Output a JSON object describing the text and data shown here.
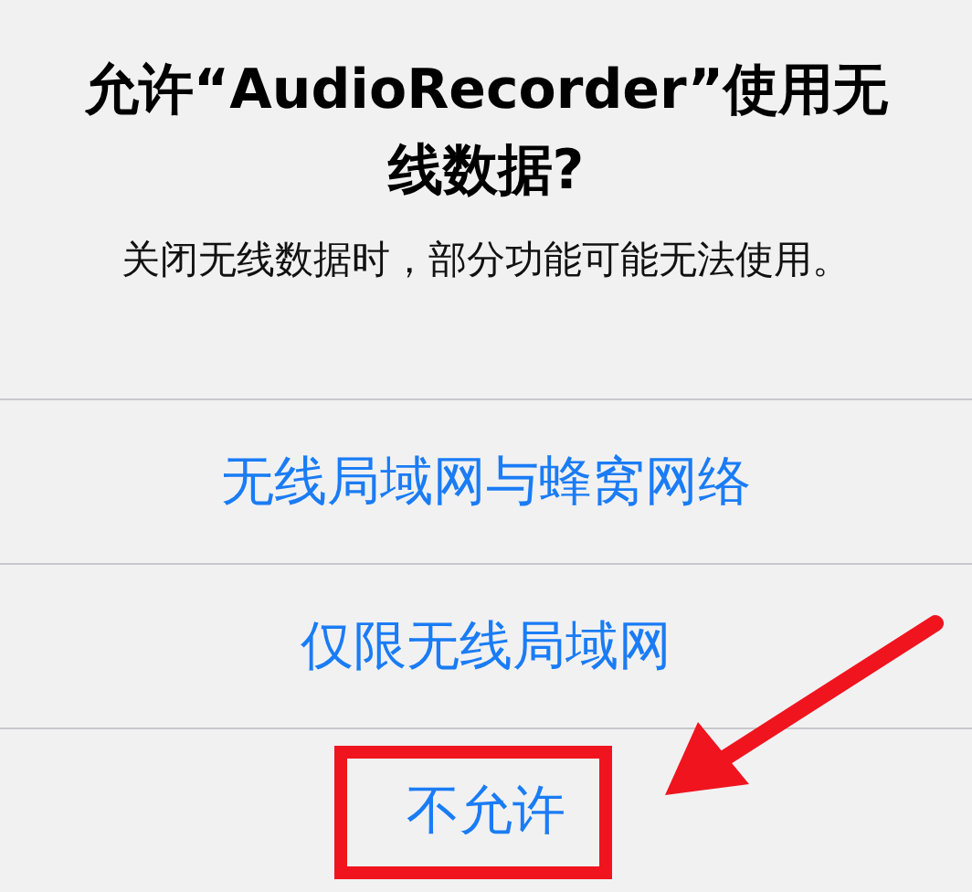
{
  "alert": {
    "title": "允许“AudioRecorder”使用无线数据?",
    "message": "关闭无线数据时，部分功能可能无法使用。",
    "buttons": [
      {
        "label": "无线局域网与蜂窝网络"
      },
      {
        "label": "仅限无线局域网"
      },
      {
        "label": "不允许"
      }
    ]
  }
}
